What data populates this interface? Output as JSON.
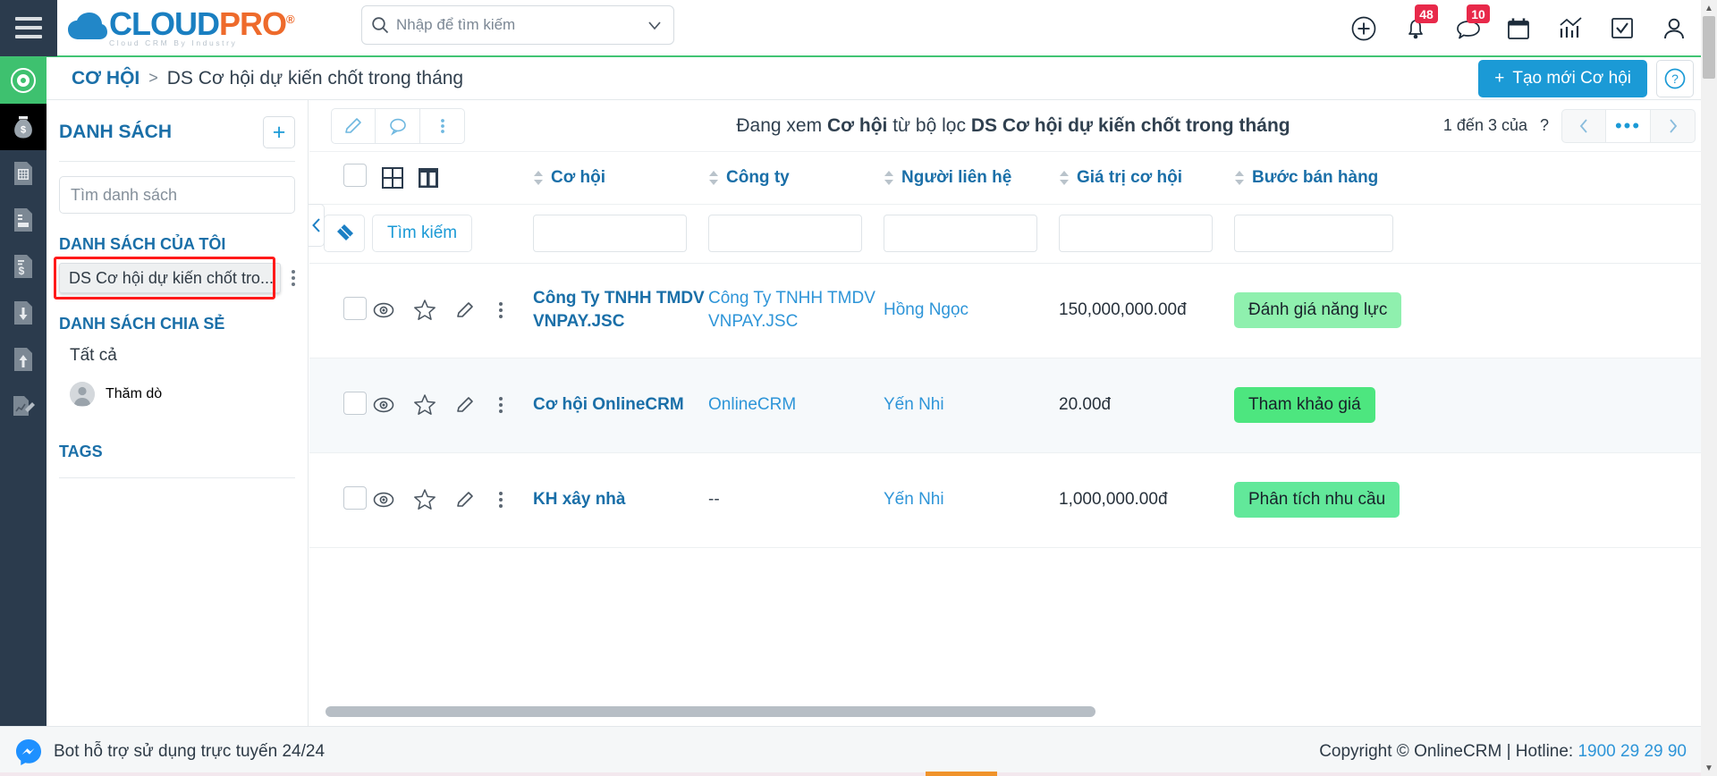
{
  "header": {
    "logo": {
      "part1": "CLOUD",
      "part2": "PRO",
      "reg": "®",
      "tagline": "Cloud CRM By Industry"
    },
    "search": {
      "placeholder": "Nhập để tìm kiếm",
      "value": ""
    },
    "icons": [
      {
        "name": "add-icon",
        "badge": ""
      },
      {
        "name": "bell-icon",
        "badge": "48"
      },
      {
        "name": "chat-icon",
        "badge": "10"
      },
      {
        "name": "calendar-icon",
        "badge": ""
      },
      {
        "name": "analytics-icon",
        "badge": ""
      },
      {
        "name": "task-icon",
        "badge": ""
      },
      {
        "name": "user-icon",
        "badge": ""
      }
    ],
    "notification_badge": "48",
    "message_badge": "10"
  },
  "breadcrumb": {
    "root": "CƠ HỘI",
    "separator": ">",
    "current": "DS Cơ hội dự kiến chốt trong tháng",
    "create_button": "Tạo mới Cơ hội",
    "create_plus": "+",
    "help": "?"
  },
  "rail": {
    "items": [
      {
        "name": "target-icon",
        "active": true
      },
      {
        "name": "money-bag-icon",
        "active": false
      },
      {
        "name": "calculator-doc-icon",
        "active": false
      },
      {
        "name": "document-icon",
        "active": false
      },
      {
        "name": "invoice-doc-icon",
        "active": false
      },
      {
        "name": "download-doc-icon",
        "active": false
      },
      {
        "name": "upload-doc-icon",
        "active": false
      },
      {
        "name": "report-edit-icon",
        "active": false
      }
    ]
  },
  "list_panel": {
    "title": "DANH SÁCH",
    "add_label": "+",
    "search_placeholder": "Tìm danh sách",
    "search_value": "",
    "my_lists_title": "DANH SÁCH CỦA TÔI",
    "my_lists": [
      "DS Cơ hội dự kiến chốt tro..."
    ],
    "shared_title": "DANH SÁCH CHIA SẺ",
    "shared_all": "Tất cả",
    "shared_user": "Thăm dò",
    "tags_title": "TAGS",
    "highlight_color": "#ff1a1a"
  },
  "main": {
    "toolbar_buttons": [
      {
        "name": "edit-button",
        "icon": "pencil-icon"
      },
      {
        "name": "comment-button",
        "icon": "comment-icon"
      },
      {
        "name": "more-button",
        "icon": "kebab-icon"
      }
    ],
    "viewing_prefix": "Đang xem",
    "viewing_entity": "Cơ hội",
    "viewing_mid": "từ bộ lọc",
    "viewing_filter": "DS Cơ hội dự kiến chốt trong tháng",
    "pagination": {
      "range": "1 đến 3 của",
      "total": "?",
      "prev": "‹",
      "more": "•••",
      "next": "›"
    }
  },
  "table": {
    "columns": [
      {
        "key": "check",
        "label": "",
        "sortable": false
      },
      {
        "key": "views",
        "label": "",
        "sortable": false
      },
      {
        "key": "opp",
        "label": "Cơ hội",
        "sortable": true
      },
      {
        "key": "comp",
        "label": "Công ty",
        "sortable": true
      },
      {
        "key": "cont",
        "label": "Người liên hệ",
        "sortable": true
      },
      {
        "key": "val",
        "label": "Giá trị cơ hội",
        "sortable": true
      },
      {
        "key": "stage",
        "label": "Bước bán hàng",
        "sortable": true
      }
    ],
    "filter_row": {
      "erase_icon": "eraser-icon",
      "search_label": "Tìm kiếm",
      "inputs": [
        "",
        "",
        "",
        ""
      ]
    },
    "view_icons": [
      {
        "name": "grid-view-icon"
      },
      {
        "name": "split-view-icon"
      }
    ],
    "row_action_icons": [
      {
        "name": "view-eye-icon"
      },
      {
        "name": "favorite-star-icon"
      },
      {
        "name": "edit-pencil-icon"
      },
      {
        "name": "row-more-icon"
      }
    ],
    "rows": [
      {
        "opportunity": "Công Ty TNHH TMDV VNPAY.JSC",
        "company": "Công Ty TNHH TMDV VNPAY.JSC",
        "contact": "Hồng Ngọc",
        "value": "150,000,000.00đ",
        "stage": "Đánh giá năng lực",
        "stage_color": "#8ff0ae"
      },
      {
        "opportunity": "Cơ hội OnlineCRM",
        "company": "OnlineCRM",
        "contact": "Yến Nhi",
        "value": "20.00đ",
        "stage": "Tham khảo giá",
        "stage_color": "#4de67f"
      },
      {
        "opportunity": "KH xây nhà",
        "company": "--",
        "contact": "Yến Nhi",
        "value": "1,000,000.00đ",
        "stage": "Phân tích nhu cầu",
        "stage_color": "#62e89a"
      }
    ]
  },
  "footer": {
    "bot_text": "Bot hỗ trợ sử dụng trực tuyến 24/24",
    "copyright": "Copyright © OnlineCRM",
    "divider": "|",
    "hotline_label": "Hotline:",
    "hotline_number": "1900 29 29 90"
  }
}
